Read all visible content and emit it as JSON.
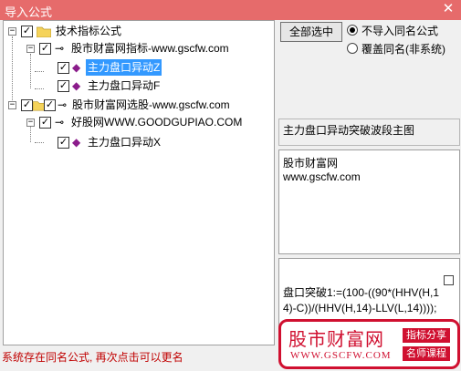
{
  "window": {
    "title": "导入公式",
    "close_glyph": "✕"
  },
  "tree": {
    "root": {
      "label": "技术指标公式",
      "checked": true
    },
    "group1": {
      "label": "股市财富网指标-www.gscfw.com",
      "checked": true
    },
    "item1": {
      "label": "主力盘口异动Z",
      "checked": true,
      "selected": true
    },
    "item2": {
      "label": "主力盘口异动F",
      "checked": true
    },
    "group2": {
      "label": "股市财富网选股-www.gscfw.com",
      "checked": true
    },
    "group3": {
      "label": "好股网WWW.GOODGUPIAO.COM",
      "checked": true
    },
    "item3": {
      "label": "主力盘口异动X",
      "checked": true
    }
  },
  "controls": {
    "select_all": "全部选中",
    "radio_no_import": "不导入同名公式",
    "radio_overwrite": "覆盖同名(非系统)",
    "radio_selected": "no_import"
  },
  "info": {
    "formula_name": "主力盘口异动突破波段主图",
    "description_line1": "股市财富网",
    "description_line2": "www.gscfw.com",
    "code_text": "盘口突破1:=(100-((90*(HHV(H,14)-C))/(HHV(H,14)-LLV(L,14))));"
  },
  "status": {
    "message": "系统存在同名公式, 再次点击可以更名"
  },
  "watermark": {
    "brand": "股市财富网",
    "url": "WWW.GSCFW.COM",
    "tag1": "指标分享",
    "tag2": "名师课程"
  },
  "colors": {
    "titlebar": "#e66b6b",
    "selection": "#3399ff",
    "status_text": "#c00000",
    "brand_red": "#d01030"
  }
}
